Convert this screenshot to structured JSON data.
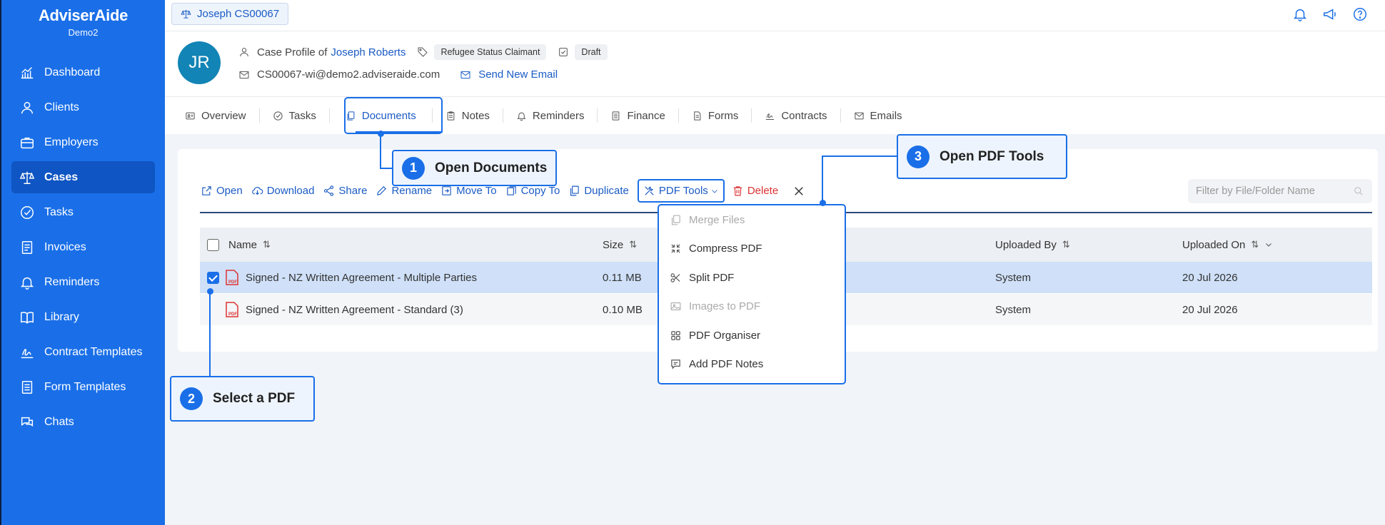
{
  "brand": {
    "name": "AdviserAide",
    "sub": "Demo2"
  },
  "sidebar": {
    "items": [
      {
        "label": "Dashboard",
        "icon": "chart-icon"
      },
      {
        "label": "Clients",
        "icon": "user-icon"
      },
      {
        "label": "Employers",
        "icon": "briefcase-icon"
      },
      {
        "label": "Cases",
        "icon": "scales-icon",
        "active": true
      },
      {
        "label": "Tasks",
        "icon": "check-circle-icon"
      },
      {
        "label": "Invoices",
        "icon": "invoice-icon"
      },
      {
        "label": "Reminders",
        "icon": "bell-icon"
      },
      {
        "label": "Library",
        "icon": "book-icon"
      },
      {
        "label": "Contract Templates",
        "icon": "signature-icon"
      },
      {
        "label": "Form Templates",
        "icon": "form-icon"
      },
      {
        "label": "Chats",
        "icon": "chat-icon"
      }
    ]
  },
  "topbar": {
    "case_tab": "Joseph CS00067"
  },
  "profile": {
    "initials": "JR",
    "case_profile_prefix": "Case Profile of",
    "client_name": "Joseph Roberts",
    "tag": "Refugee Status Claimant",
    "status": "Draft",
    "email": "CS00067-wi@demo2.adviseraide.com",
    "send_email": "Send New Email"
  },
  "tabs": [
    {
      "label": "Overview",
      "icon": "id-card-icon"
    },
    {
      "label": "Tasks",
      "icon": "check-circle-icon"
    },
    {
      "label": "Documents",
      "icon": "documents-icon",
      "active": true
    },
    {
      "label": "Notes",
      "icon": "clipboard-icon"
    },
    {
      "label": "Reminders",
      "icon": "bell-icon"
    },
    {
      "label": "Finance",
      "icon": "ledger-icon"
    },
    {
      "label": "Forms",
      "icon": "form-icon"
    },
    {
      "label": "Contracts",
      "icon": "signature-icon"
    },
    {
      "label": "Emails",
      "icon": "mail-icon"
    }
  ],
  "toolbar": {
    "open": "Open",
    "download": "Download",
    "share": "Share",
    "rename": "Rename",
    "move_to": "Move To",
    "copy_to": "Copy To",
    "duplicate": "Duplicate",
    "pdf_tools": "PDF Tools",
    "delete": "Delete"
  },
  "filter": {
    "placeholder": "Filter by File/Folder Name"
  },
  "table": {
    "columns": {
      "name": "Name",
      "size": "Size",
      "uploaded_by": "Uploaded By",
      "uploaded_on": "Uploaded On"
    },
    "rows": [
      {
        "name": "Signed - NZ Written Agreement - Multiple Parties",
        "size": "0.11 MB",
        "uploaded_by": "System",
        "uploaded_on": "20 Jul 2026",
        "selected": true
      },
      {
        "name": "Signed - NZ Written Agreement - Standard (3)",
        "size": "0.10 MB",
        "uploaded_by": "System",
        "uploaded_on": "20 Jul 2026",
        "selected": false
      }
    ]
  },
  "pdf_tools_menu": [
    {
      "label": "Merge Files",
      "disabled": true
    },
    {
      "label": "Compress PDF",
      "disabled": false
    },
    {
      "label": "Split PDF",
      "disabled": false
    },
    {
      "label": "Images to PDF",
      "disabled": true
    },
    {
      "label": "PDF Organiser",
      "disabled": false
    },
    {
      "label": "Add PDF Notes",
      "disabled": false
    }
  ],
  "callouts": [
    {
      "num": "1",
      "text": "Open Documents"
    },
    {
      "num": "2",
      "text": "Select a PDF"
    },
    {
      "num": "3",
      "text": "Open PDF Tools"
    }
  ],
  "colors": {
    "accent": "#1a6fe8",
    "sidebar": "#1a6fe8",
    "delete": "#dd3333",
    "selected_row": "#cfe0f8"
  }
}
